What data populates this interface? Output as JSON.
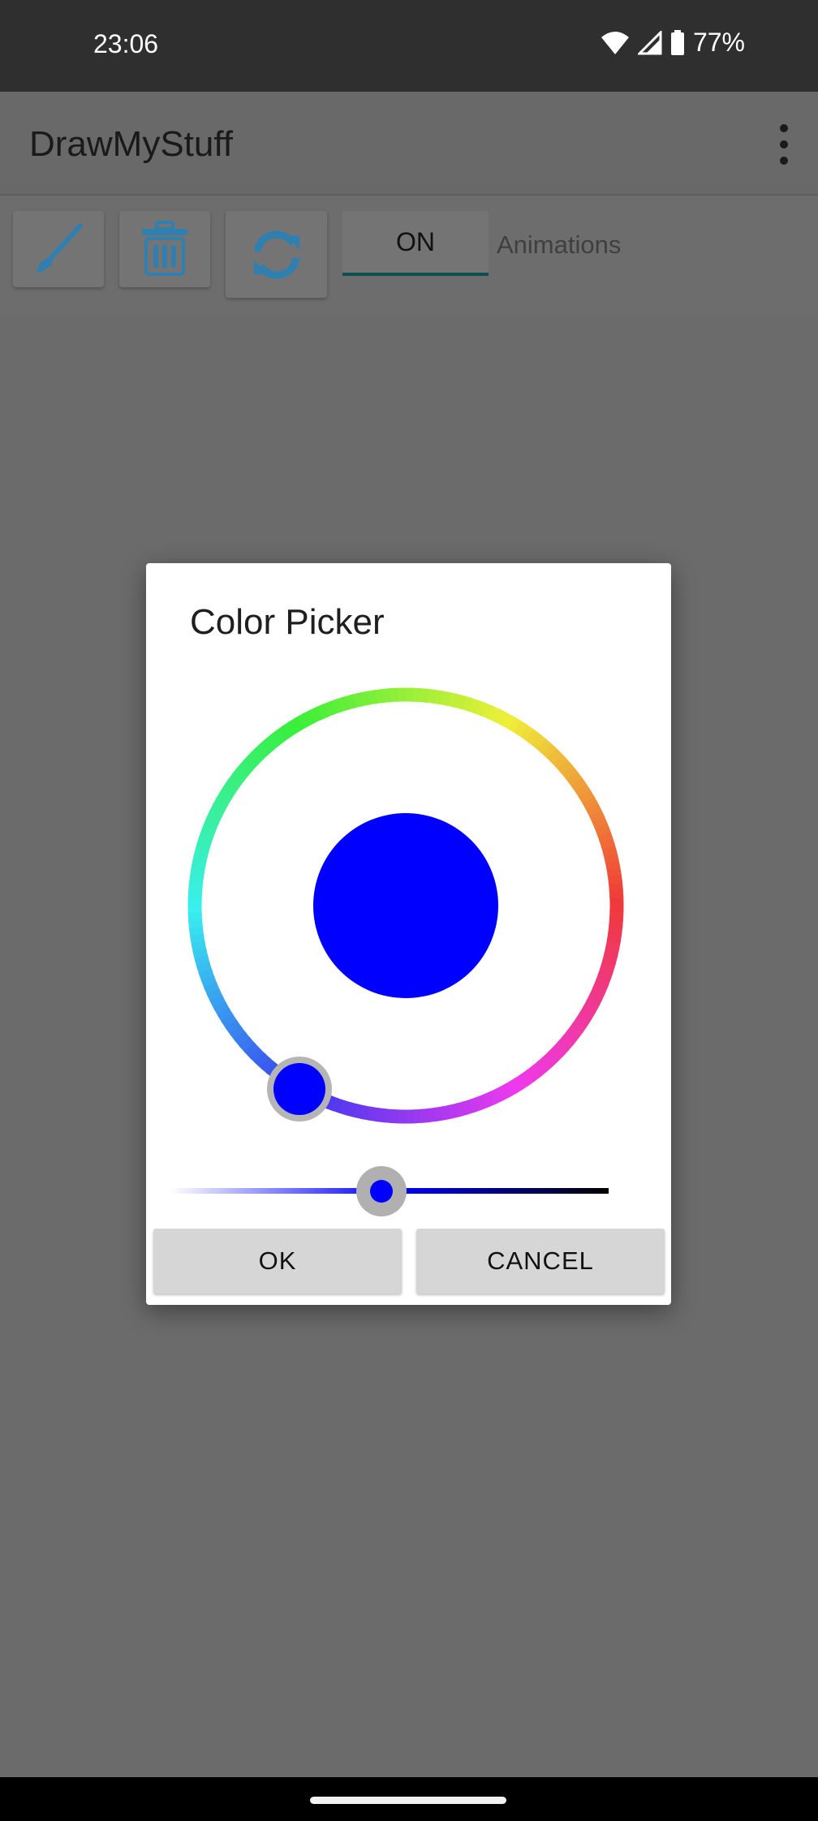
{
  "status": {
    "time": "23:06",
    "battery": "77%"
  },
  "app": {
    "title": "DrawMyStuff"
  },
  "toolbar": {
    "toggle_label": "ON",
    "toggle_caption": "Animations"
  },
  "dialog": {
    "title": "Color Picker",
    "selected_color": "#0000ff",
    "hue_selector_color": "#0000ff",
    "saturation_value_fraction": 0.5,
    "ok_label": "OK",
    "cancel_label": "CANCEL"
  },
  "colors": {
    "accent_tool_icon": "#2f7fb1",
    "scrim": "#6b6b6b"
  }
}
